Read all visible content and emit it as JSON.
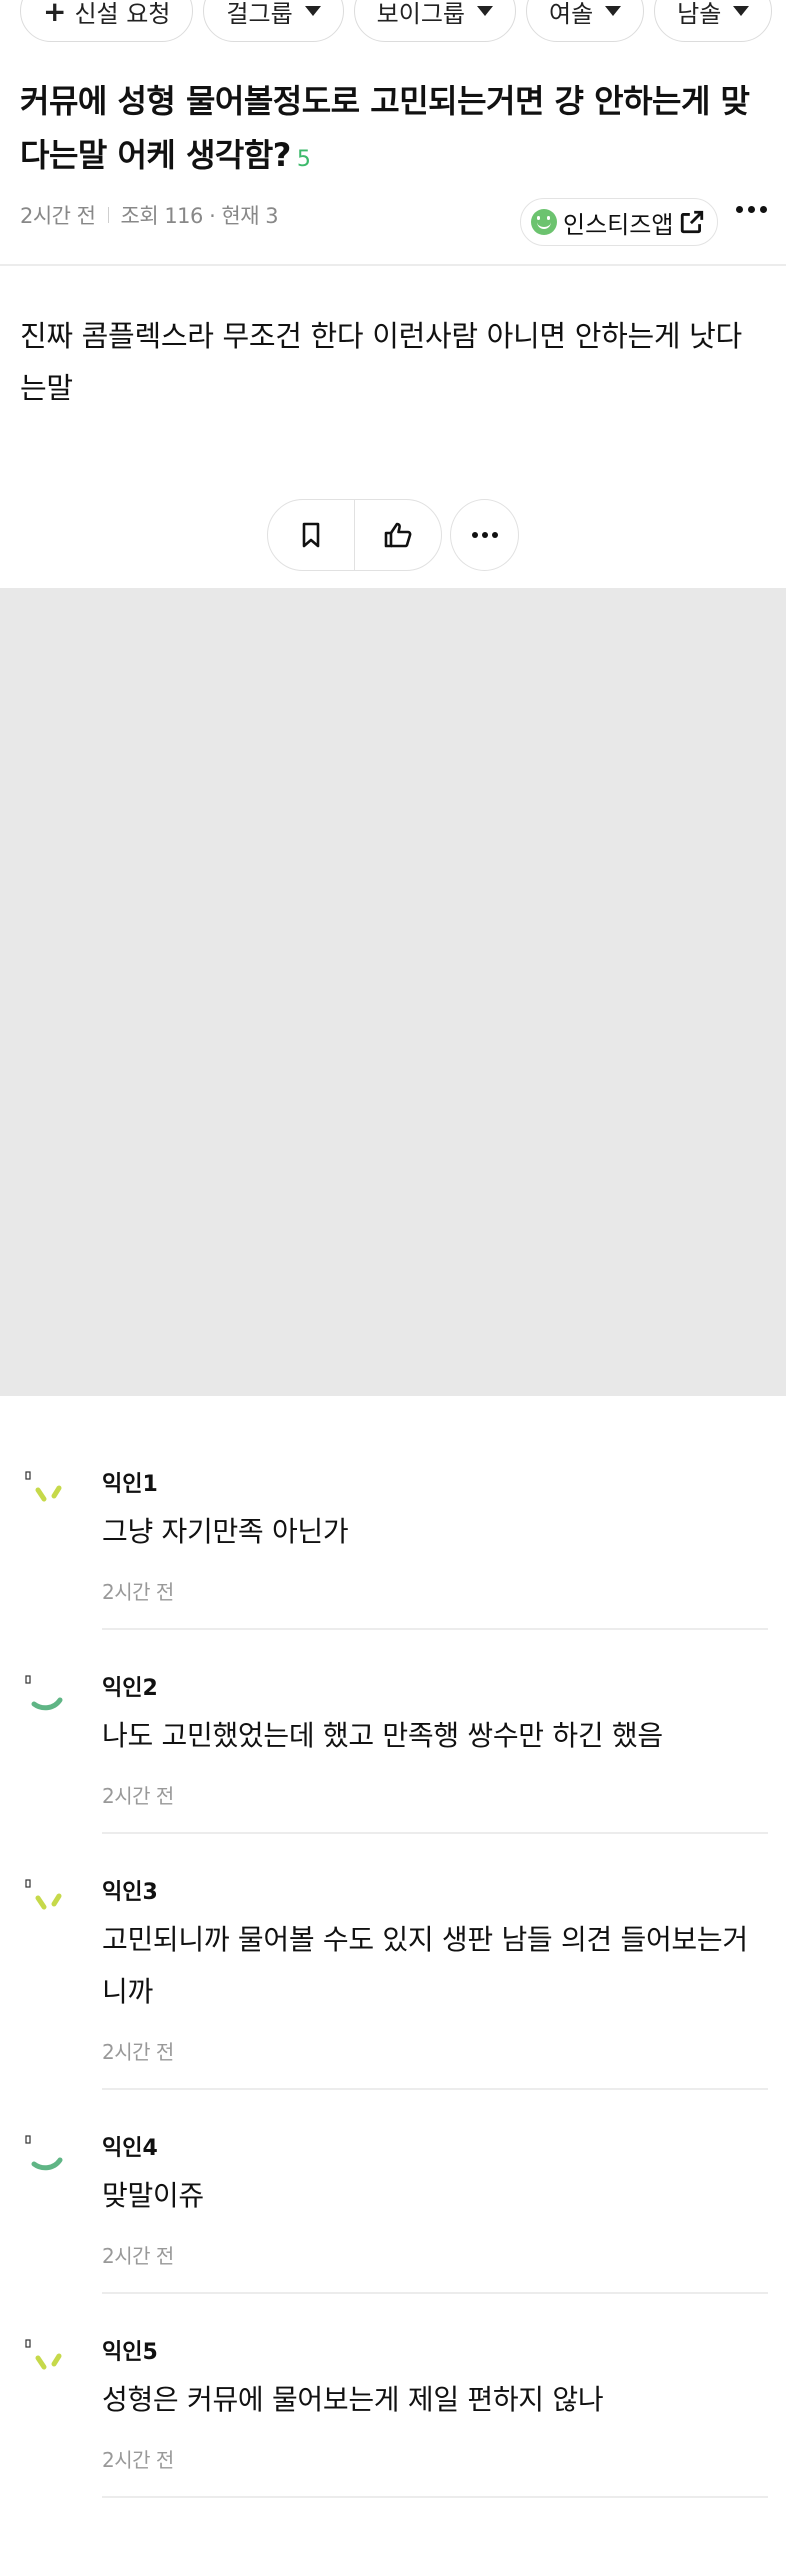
{
  "chips": [
    {
      "label": "신설 요청",
      "icon": "plus-icon"
    },
    {
      "label": "걸그룹",
      "icon": "caret-down-icon"
    },
    {
      "label": "보이그룹",
      "icon": "caret-down-icon"
    },
    {
      "label": "여솔",
      "icon": "caret-down-icon"
    },
    {
      "label": "남솔",
      "icon": "caret-down-icon"
    }
  ],
  "post": {
    "title": "커뮤에 성형 물어볼정도로 고민되는거면 걍 안하는게 맞다는말 어케 생각함?",
    "comment_count": "5",
    "time": "2시간 전",
    "views": "조회 116 · 현재 3",
    "app_button": "인스티즈앱",
    "body": "진짜 콤플렉스라 무조건 한다 이런사람 아니면 안하는게 낫다는말"
  },
  "comments": [
    {
      "name": "익인1",
      "text": "그냥 자기만족 아닌가",
      "time": "2시간 전",
      "avatar": "yellow-green"
    },
    {
      "name": "익인2",
      "text": "나도 고민했었는데 했고 만족행 쌍수만 하긴 했음",
      "time": "2시간 전",
      "avatar": "green"
    },
    {
      "name": "익인3",
      "text": "고민되니까 물어볼 수도 있지 생판 남들 의견 들어보는거니까",
      "time": "2시간 전",
      "avatar": "yellow-green"
    },
    {
      "name": "익인4",
      "text": "맞말이쥬",
      "time": "2시간 전",
      "avatar": "green"
    },
    {
      "name": "익인5",
      "text": "성형은 커뮤에 물어보는게 제일 편하지 않나",
      "time": "2시간 전",
      "avatar": "yellow-green"
    }
  ],
  "colors": {
    "accent_green": "#3dba6b",
    "app_smile": "#6cc36f",
    "avatar_yellow_green": "#c6d94a",
    "avatar_green": "#5fb585",
    "ad_background": "#e8e8e8"
  }
}
